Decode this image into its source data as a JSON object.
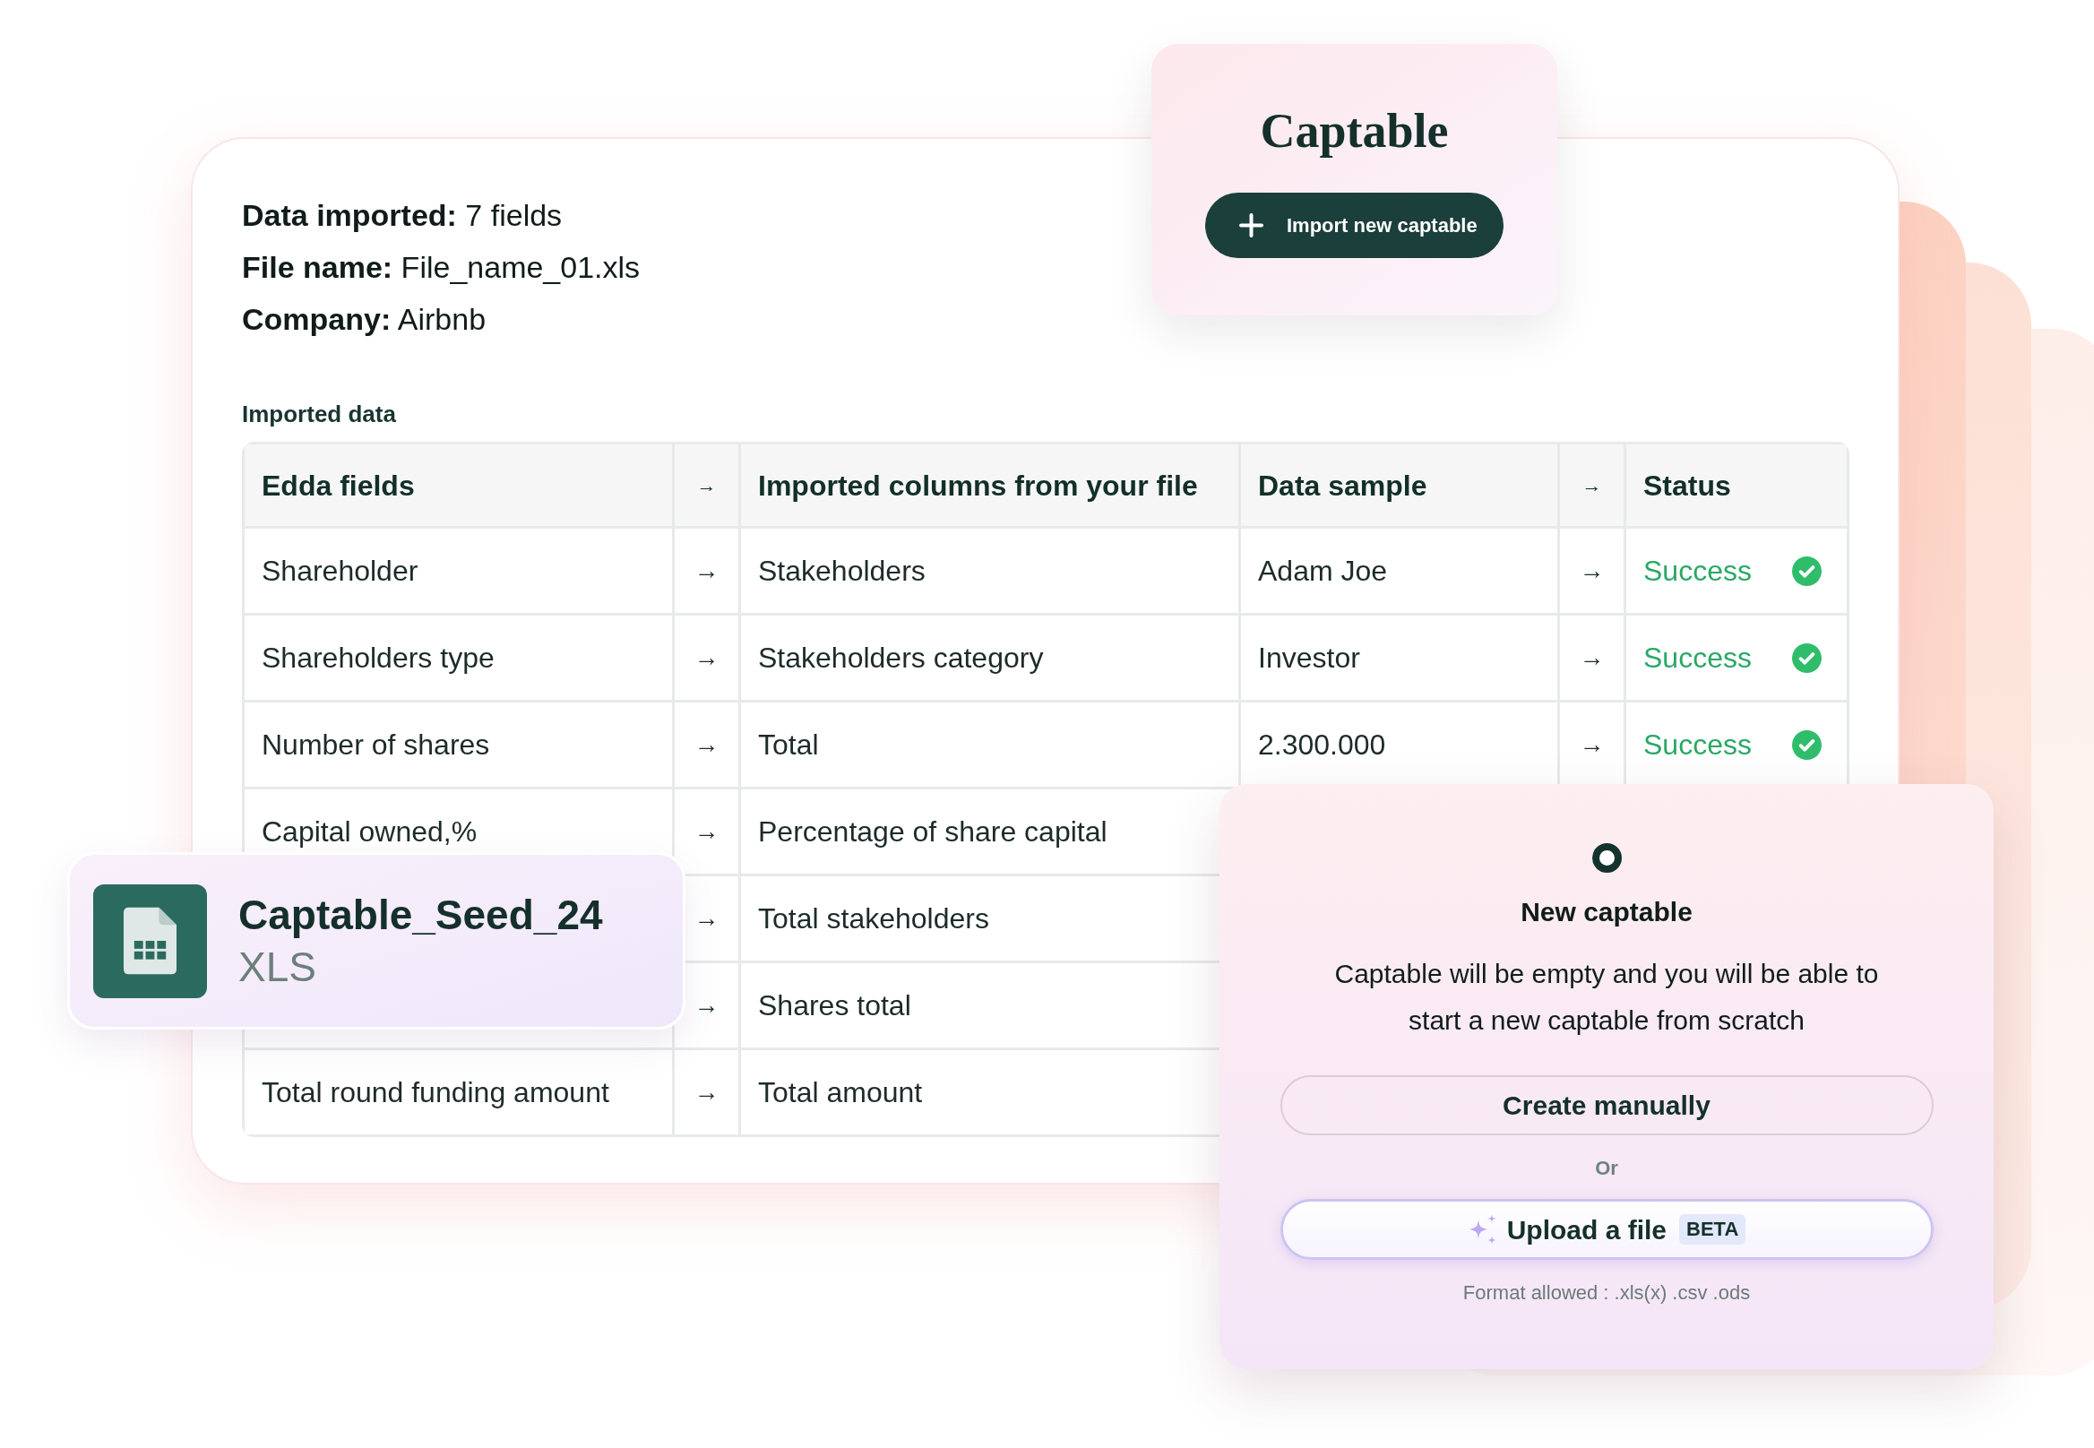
{
  "import_summary": [
    "**Data imported:** 7 fields",
    "**File name:** File_name_01.xls",
    "**Company:** Airbnb"
  ],
  "captable_card": {
    "title": "Captable",
    "button_label": "Import new captable"
  },
  "section_label": "Imported data",
  "table": {
    "columns": [
      "Edda fields",
      "→",
      "Imported columns from your file",
      "Data sample",
      "→",
      "Status"
    ],
    "rows": [
      {
        "edda_field": "Shareholder",
        "arrow": "→",
        "imported_column": "Stakeholders",
        "data_sample": "Adam Joe",
        "arrow_2": "→",
        "status": {
          "kind": "success",
          "text": "Success"
        }
      },
      {
        "edda_field": "Shareholders type",
        "arrow": "→",
        "imported_column": "Stakeholders category",
        "data_sample": "Investor",
        "arrow_2": "→",
        "status": {
          "kind": "success",
          "text": "Success"
        }
      },
      {
        "edda_field": "Number of shares",
        "arrow": "→",
        "imported_column": "Total",
        "data_sample": "2.300.000",
        "arrow_2": "→",
        "status": {
          "kind": "success",
          "text": "Success"
        }
      },
      {
        "edda_field": "Capital owned,%",
        "arrow": "→",
        "imported_column": "Percentage of share capital"
      },
      {
        "arrow": "→",
        "imported_column": "Total stakeholders"
      },
      {
        "arrow": "→",
        "imported_column": "Shares total"
      },
      {
        "edda_field": "Total round funding amount",
        "arrow": "→",
        "imported_column": "Total amount"
      }
    ]
  },
  "file_card": {
    "name": "Captable_Seed_24",
    "type": "XLS"
  },
  "new_captable_dialog": {
    "title": "New captable",
    "description": "Captable will be empty and you will be able to start a new captable from scratch",
    "create_button": "Create manually",
    "separator": "Or",
    "upload_button": {
      "label": "Upload a file",
      "badge": "BETA"
    },
    "format_hint": "Format allowed : .xls(x) .csv .ods"
  }
}
